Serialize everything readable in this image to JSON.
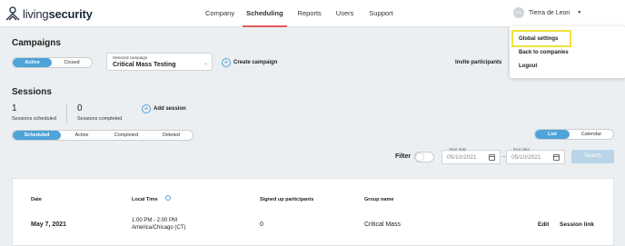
{
  "header": {
    "logo_light": "living",
    "logo_bold": "security",
    "nav": [
      "Company",
      "Scheduling",
      "Reports",
      "Users",
      "Support"
    ],
    "user_initials": "TDL",
    "user_name": "Tierra de Leon",
    "caret": "▼"
  },
  "user_menu": {
    "items": [
      "Global settings",
      "Back to companies",
      "Logout"
    ]
  },
  "campaigns": {
    "title": "Campaigns",
    "status_tabs": [
      "Active",
      "Closed"
    ],
    "selected_label": "Selected campaign",
    "selected_value": "Critical Mass Testing",
    "create_label": "Create campaign",
    "invite_label": "Invite participants"
  },
  "sessions": {
    "title": "Sessions",
    "scheduled_count": "1",
    "scheduled_label": "Sessions scheduled",
    "completed_count": "0",
    "completed_label": "Sessions completed",
    "add_label": "Add session",
    "filter_tabs": [
      "Scheduled",
      "Active",
      "Completed",
      "Deleted"
    ],
    "view_tabs": [
      "List",
      "Calendar"
    ]
  },
  "filter": {
    "label": "Filter",
    "start_label": "Start date",
    "start_value": "05/10/2021",
    "end_label": "End date",
    "end_value": "05/10/2021",
    "search_label": "Search"
  },
  "table": {
    "headers": [
      "Date",
      "Local Time",
      "Signed up participants",
      "Group name"
    ],
    "row": {
      "date": "May 7, 2021",
      "time_line1": "1:00 PM - 2:00 PM",
      "time_line2": "America/Chicago (CT)",
      "participants": "0",
      "group": "Critical Mass",
      "edit": "Edit",
      "session_link": "Session link"
    }
  },
  "colors": {
    "accent": "#4ea3d8",
    "nav_underline": "#e25a5a",
    "highlight_box": "#f1e13b",
    "background": "#eceff1"
  }
}
